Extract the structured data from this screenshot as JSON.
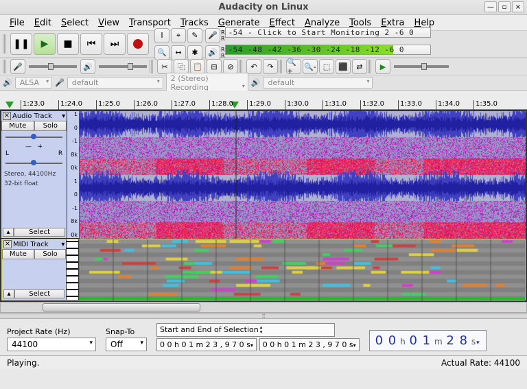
{
  "title": "Audacity on Linux",
  "menu": [
    "File",
    "Edit",
    "Select",
    "View",
    "Transport",
    "Tracks",
    "Generate",
    "Effect",
    "Analyze",
    "Tools",
    "Extra",
    "Help"
  ],
  "rec_meter": {
    "text": "-54 - Click to Start Monitoring 2  -6  0"
  },
  "play_meter": {
    "ticks": "-54 -48 -42 -36 -30 -24 -18 -12  -6  0"
  },
  "device": {
    "host": "ALSA",
    "rec": "default",
    "chan": "2 (Stereo) Recording",
    "play": "default"
  },
  "time_ticks": [
    "1:23.0",
    "1:24.0",
    "1:25.0",
    "1:26.0",
    "1:27.0",
    "1:28.0",
    "1:29.0",
    "1:30.0",
    "1:31.0",
    "1:32.0",
    "1:33.0",
    "1:34.0",
    "1:35.0"
  ],
  "track1": {
    "name": "Audio Track",
    "mute": "Mute",
    "solo": "Solo",
    "L": "L",
    "R": "R",
    "info1": "Stereo, 44100Hz",
    "info2": "32-bit float",
    "scale": [
      "1",
      "0",
      "-1",
      "8k",
      "0k",
      "1",
      "0",
      "-1",
      "8k",
      "0k"
    ],
    "select": "Select"
  },
  "track2": {
    "name": "MIDI Track",
    "mute": "Mute",
    "solo": "Solo",
    "select": "Select"
  },
  "proj_rate_label": "Project Rate (Hz)",
  "proj_rate": "44100",
  "snap_label": "Snap-To",
  "snap": "Off",
  "sel_label": "Start and End of Selection",
  "sel_start": "0 0 h 0 1 m 2 3 , 9 7 0 s",
  "sel_end": "0 0 h 0 1 m 2 3 , 9 7 0 s",
  "time_display": {
    "h": "0 0",
    "m": "0 1",
    "s": "2 8"
  },
  "status_left": "Playing.",
  "status_right": "Actual Rate: 44100"
}
